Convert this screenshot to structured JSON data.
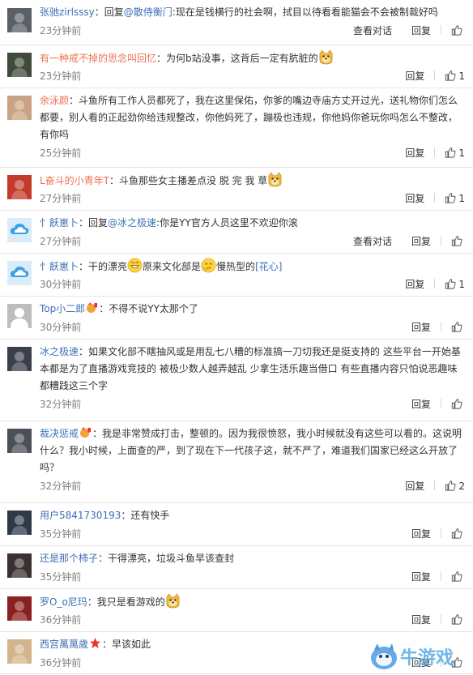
{
  "comments": [
    {
      "user": "张驰zirlsssy",
      "parts": [
        {
          "t": "text",
          "v": "：回复"
        },
        {
          "t": "mention",
          "v": "@散侍衡门"
        },
        {
          "t": "text",
          "v": ":现在是钱横行的社会啊，拭目以待看看能猫会不会被制裁好吗"
        }
      ],
      "time": "23分钟前",
      "view_label": "查看对话",
      "reply_label": "回复",
      "likes": ""
    },
    {
      "user": "有一种戒不掉的思念叫回忆",
      "parts": [
        {
          "t": "text",
          "v": "：为何b站没事，这背后一定有肮脏的"
        },
        {
          "t": "emoji",
          "v": "doge"
        }
      ],
      "time": "23分钟前",
      "view_label": "",
      "reply_label": "回复",
      "likes": "1"
    },
    {
      "user": "余泳颜",
      "parts": [
        {
          "t": "text",
          "v": "：斗鱼所有工作人员都死了，我在这里保佑，你爹的嘴边寺庙方丈开过光，送礼物你们怎么都要，别人看的正起劲你给违规整改，你他妈死了，蹦极也违规，你他妈你爸玩你吗怎么不整改，有你吗"
        }
      ],
      "time": "25分钟前",
      "view_label": "",
      "reply_label": "回复",
      "likes": "1"
    },
    {
      "user": "L奋斗的小青年T",
      "parts": [
        {
          "t": "text",
          "v": "：斗鱼那些女主播差点没 脱 完 我 草"
        },
        {
          "t": "emoji",
          "v": "doge"
        }
      ],
      "time": "27分钟前",
      "view_label": "",
      "reply_label": "回复",
      "likes": "1"
    },
    {
      "user": "忄飫崽卜",
      "parts": [
        {
          "t": "text",
          "v": "：回复"
        },
        {
          "t": "mention",
          "v": "@冰之极速"
        },
        {
          "t": "text",
          "v": ":你是YY官方人员这里不欢迎你滚"
        }
      ],
      "time": "27分钟前",
      "view_label": "查看对话",
      "reply_label": "回复",
      "likes": ""
    },
    {
      "user": "忄飫崽卜",
      "parts": [
        {
          "t": "text",
          "v": "：干的漂亮"
        },
        {
          "t": "emoji",
          "v": "grin"
        },
        {
          "t": "text",
          "v": "原来文化部是"
        },
        {
          "t": "emoji",
          "v": "think"
        },
        {
          "t": "text",
          "v": "慢热型的"
        },
        {
          "t": "tag",
          "v": "[花心]"
        }
      ],
      "time": "30分钟前",
      "view_label": "",
      "reply_label": "回复",
      "likes": "1"
    },
    {
      "user": "Top小二郎",
      "badge": "vip",
      "parts": [
        {
          "t": "text",
          "v": "：不得不说YY太那个了"
        }
      ],
      "time": "30分钟前",
      "view_label": "",
      "reply_label": "回复",
      "likes": ""
    },
    {
      "user": "冰之极速",
      "parts": [
        {
          "t": "text",
          "v": "：如果文化部不瞎抽风或是用乱七八糟的标准搞一刀切我还是挺支持的 这些平台一开始基本都是为了直播游戏竞技的 被极少数人越弄越乱 少拿生活乐趣当借口 有些直播内容只怕说恶趣味都糟践这三个字"
        }
      ],
      "time": "32分钟前",
      "view_label": "",
      "reply_label": "回复",
      "likes": ""
    },
    {
      "user": "裁决惩戒",
      "badge": "vip",
      "parts": [
        {
          "t": "text",
          "v": "：我是非常赞成打击，整顿的。因为我很愤怒，我小时候就没有这些可以看的。这说明什么？我小时候，上面查的严，到了现在下一代孩子这，就不严了，难道我们国家已经这么开放了吗？"
        }
      ],
      "time": "32分钟前",
      "view_label": "",
      "reply_label": "回复",
      "likes": "2"
    },
    {
      "user": "用户5841730193",
      "parts": [
        {
          "t": "text",
          "v": "：还有快手"
        }
      ],
      "time": "35分钟前",
      "view_label": "",
      "reply_label": "回复",
      "likes": ""
    },
    {
      "user": "还是那个柿子",
      "parts": [
        {
          "t": "text",
          "v": "：干得漂亮，垃圾斗鱼早该查封"
        }
      ],
      "time": "35分钟前",
      "view_label": "",
      "reply_label": "回复",
      "likes": ""
    },
    {
      "user": "罗O_o尼玛",
      "parts": [
        {
          "t": "text",
          "v": "：我只是看游戏的"
        },
        {
          "t": "emoji",
          "v": "doge"
        }
      ],
      "time": "36分钟前",
      "view_label": "",
      "reply_label": "回复",
      "likes": ""
    },
    {
      "user": "西宫萬萬歲",
      "badge": "star",
      "parts": [
        {
          "t": "text",
          "v": "：早该如此"
        }
      ],
      "time": "36分钟前",
      "view_label": "",
      "reply_label": "回复",
      "likes": ""
    }
  ],
  "watermark": {
    "text": "牛游戏",
    "icon": "cartoon-mascot-icon"
  },
  "colors": {
    "username": "#eb7350",
    "link": "#3c6fb6",
    "time": "#808080",
    "divider": "#e6e6e6"
  }
}
